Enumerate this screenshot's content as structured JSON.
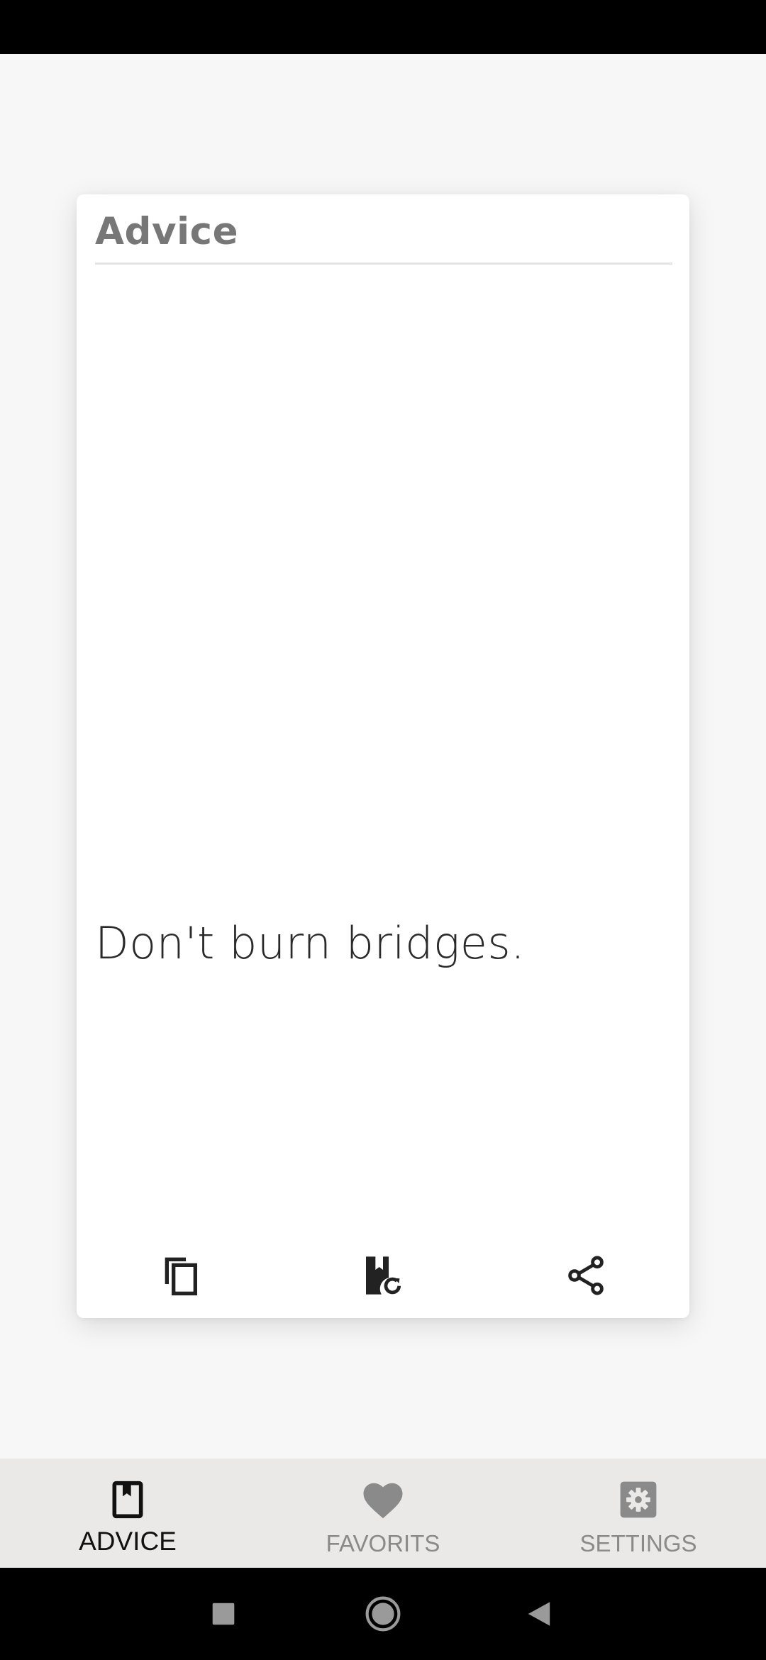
{
  "card": {
    "title": "Advice",
    "advice": "Don't burn bridges.",
    "actions": [
      {
        "name": "copy",
        "icon": "copy-icon"
      },
      {
        "name": "new-advice",
        "icon": "bookmark-refresh-icon"
      },
      {
        "name": "share",
        "icon": "share-icon"
      }
    ]
  },
  "bottom_nav": {
    "items": [
      {
        "label": "ADVICE",
        "icon": "bookmark-book-icon",
        "active": true
      },
      {
        "label": "FAVORITS",
        "icon": "heart-icon",
        "active": false
      },
      {
        "label": "SETTINGS",
        "icon": "gear-icon",
        "active": false
      }
    ]
  },
  "colors": {
    "background": "#f7f7f7",
    "card": "#ffffff",
    "title": "#777777",
    "nav_background": "#ebe8e8",
    "nav_active": "#111111",
    "nav_inactive": "#8a8a8a"
  }
}
